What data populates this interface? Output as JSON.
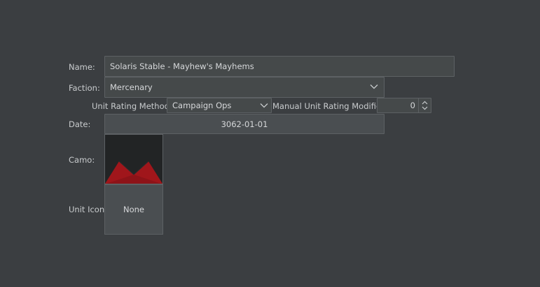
{
  "form": {
    "name_label": "Name:",
    "name_value": "Solaris Stable - Mayhew's Mayhems",
    "faction_label": "Faction:",
    "faction_value": "Mercenary",
    "rating_method_label": "Unit Rating Method:",
    "rating_method_value": "Campaign Ops",
    "manual_modifier_label": "Manual Unit Rating Modifier",
    "manual_modifier_value": "0",
    "date_label": "Date:",
    "date_value": "3062-01-01",
    "camo_label": "Camo:",
    "unit_icon_label": "Unit Icon:",
    "unit_icon_value": "None"
  },
  "icons": {
    "faction_dropdown": "chevron-down-icon",
    "rating_dropdown": "chevron-down-icon",
    "spinner": "spinner-arrows-icon"
  },
  "colors": {
    "background": "#3b3e41",
    "field": "#45494a",
    "border": "#5d6164",
    "camo_red": "#a0161b",
    "camo_dark": "#222425"
  }
}
